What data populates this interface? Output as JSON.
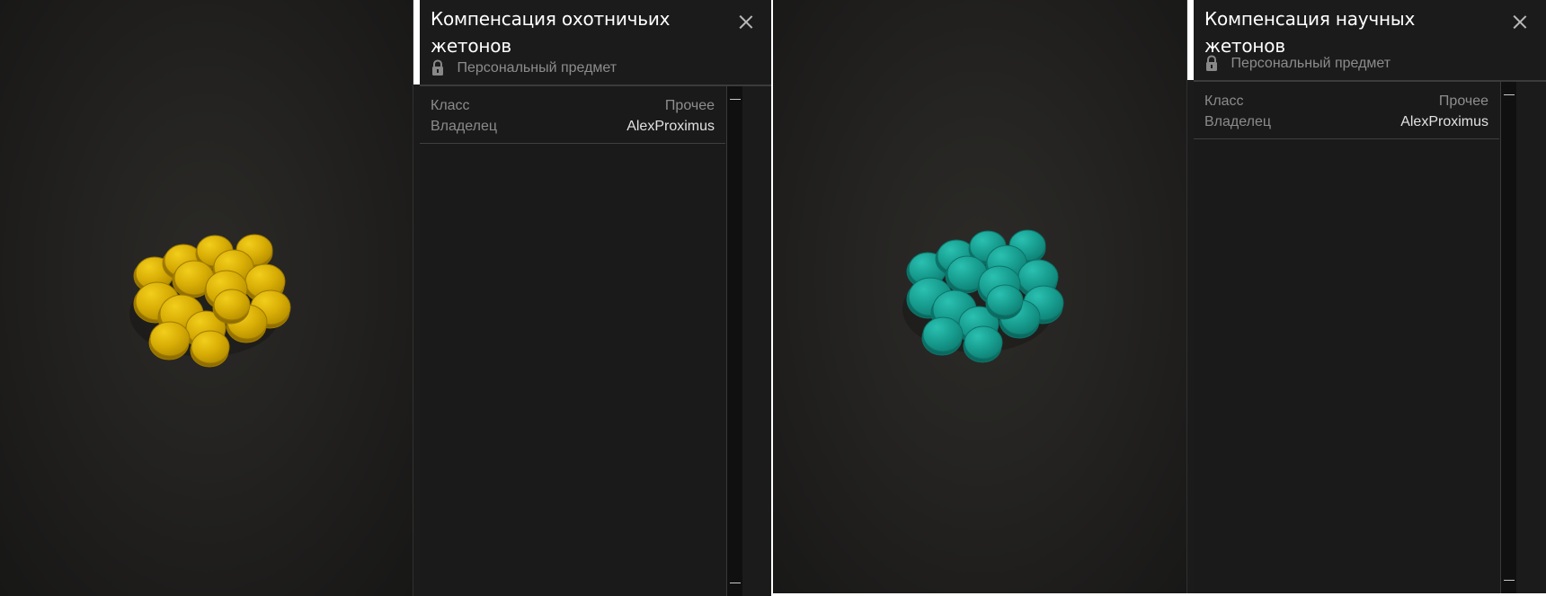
{
  "cards": [
    {
      "title": "Компенсация охотничьих жетонов",
      "personal_item": "Персональный предмет",
      "properties": {
        "class_label": "Класс",
        "class_value": "Прочее",
        "owner_label": "Владелец",
        "owner_value": "AlexProximus"
      },
      "token_color": "#e6b800"
    },
    {
      "title": "Компенсация научных жетонов",
      "personal_item": "Персональный предмет",
      "properties": {
        "class_label": "Класс",
        "class_value": "Прочее",
        "owner_label": "Владелец",
        "owner_value": "AlexProximus"
      },
      "token_color": "#1aa99a"
    }
  ],
  "icons": {
    "close": "close-icon",
    "lock": "lock-icon",
    "scroll_up": "scroll-up-icon",
    "scroll_down": "scroll-down-icon"
  }
}
